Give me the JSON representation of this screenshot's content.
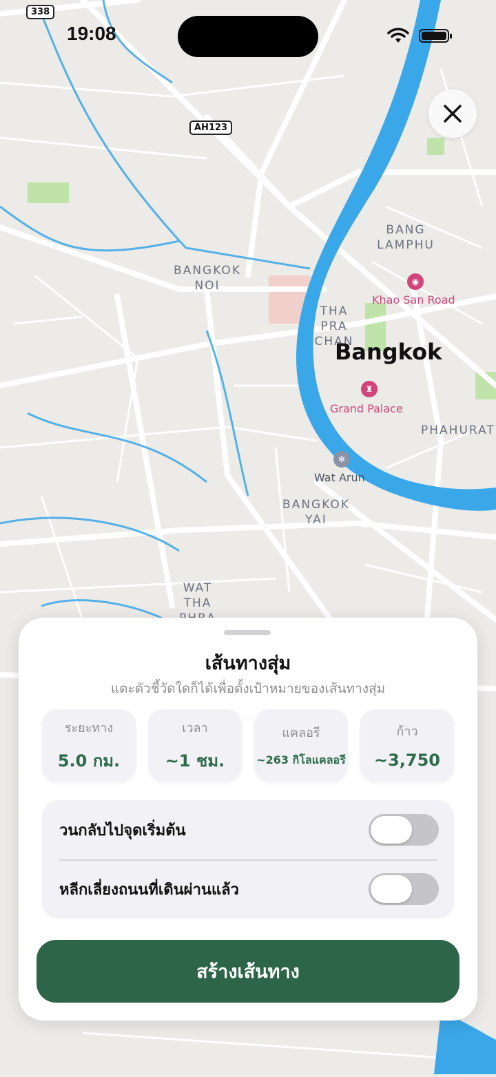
{
  "status_bar": {
    "time": "19:08"
  },
  "map": {
    "shields": [
      "338",
      "AH123"
    ],
    "labels": {
      "bangkok_noi": "BANGKOK NOI",
      "bang_lamphu": "BANG LAMPHU",
      "tha_pra_chan": "THA PRA CHAN",
      "bangkok": "Bangkok",
      "khao_san": "Khao San Road",
      "grand_palace": "Grand Palace",
      "phahurat": "PHAHURAT",
      "wat_arun": "Wat Arun",
      "bangkok_yai": "BANGKOK YAI",
      "wat_tha_phra": "WAT THA PHRA"
    },
    "colors": {
      "water": "#3aa7e8",
      "land": "#ecebe8",
      "road": "#ffffff",
      "park": "#bfe3a8"
    }
  },
  "close_button": {
    "icon": "close-icon"
  },
  "sheet": {
    "title": "เส้นทางสุ่ม",
    "subtitle": "แตะตัวชี้วัดใดก็ได้เพื่อตั้งเป้าหมายของเส้นทางสุ่ม",
    "stats": [
      {
        "label": "ระยะทาง",
        "value": "5.0 กม."
      },
      {
        "label": "เวลา",
        "value": "~1 ชม."
      },
      {
        "label": "แคลอรี",
        "value": "~263 กิโลแคลอรี"
      },
      {
        "label": "ก้าว",
        "value": "~3,750"
      }
    ],
    "options": [
      {
        "label": "วนกลับไปจุดเริ่มต้น",
        "enabled": false
      },
      {
        "label": "หลีกเลี่ยงถนนที่เดินผ่านแล้ว",
        "enabled": false
      }
    ],
    "primary_button": "สร้างเส้นทาง",
    "accent_color": "#2c6548"
  }
}
